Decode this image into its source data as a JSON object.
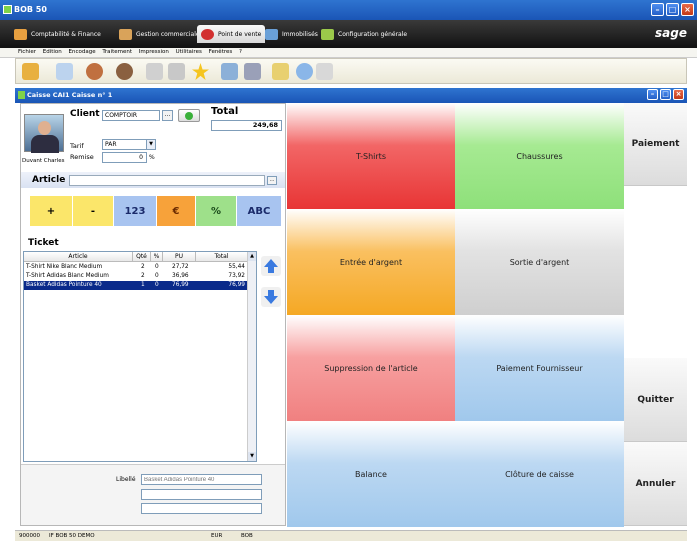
{
  "app": {
    "title": "BOB 50"
  },
  "modules": [
    {
      "label": "Comptabilité & Finance",
      "icon": "ledger-icon"
    },
    {
      "label": "Gestion commerciale",
      "icon": "commerce-icon"
    },
    {
      "label": "Point de vente",
      "icon": "pos-icon"
    },
    {
      "label": "Immobilisés",
      "icon": "assets-icon"
    },
    {
      "label": "Configuration générale",
      "icon": "config-icon"
    }
  ],
  "brand": "sage",
  "menu": [
    "Fichier",
    "Edition",
    "Encodage",
    "Traitement",
    "Impression",
    "Utilitaires",
    "Fenêtres",
    "?"
  ],
  "caisse_window": {
    "title": "Caisse   CAI1   Caisse n° 1"
  },
  "client": {
    "label": "Client",
    "value": "COMPTOIR",
    "name": "Duvant Charles",
    "tarif_label": "Tarif",
    "tarif_value": "PAR",
    "remise_label": "Remise",
    "remise_value": "0",
    "remise_unit": "%"
  },
  "total": {
    "label": "Total",
    "value": "249,68"
  },
  "article": {
    "label": "Article",
    "value": ""
  },
  "keypad": [
    "+",
    "-",
    "123",
    "€",
    "%",
    "ABC"
  ],
  "ticket": {
    "label": "Ticket",
    "columns": [
      "Article",
      "Qté",
      "%",
      "PU",
      "Total"
    ],
    "rows": [
      {
        "article": "T-Shirt Nike Blanc Medium",
        "qte": "2",
        "pct": "0",
        "pu": "27,72",
        "total": "55,44",
        "selected": false
      },
      {
        "article": "T-Shirt Adidas Blanc Medium",
        "qte": "2",
        "pct": "0",
        "pu": "36,96",
        "total": "73,92",
        "selected": false
      },
      {
        "article": "Basket Adidas Pointure 40",
        "qte": "1",
        "pct": "0",
        "pu": "76,99",
        "total": "76,99",
        "selected": true
      }
    ]
  },
  "libelle": {
    "label": "Libellé",
    "placeholder": "Basket Adidas Pointure 40"
  },
  "categories": [
    {
      "label": "T-Shirts",
      "color": "#f04646"
    },
    {
      "label": "Chaussures",
      "color": "#8ee07a"
    },
    {
      "label": "Entrée d'argent",
      "color": "#f7b030"
    },
    {
      "label": "Sortie d'argent",
      "color": "#d8d8d8"
    },
    {
      "label": "Suppression de l'article",
      "color": "#f58c8c"
    },
    {
      "label": "Paiement Fournisseur",
      "color": "#a9ceee"
    },
    {
      "label": "Balance",
      "color": "#a9ceee"
    },
    {
      "label": "Clôture de caisse",
      "color": "#a9ceee"
    }
  ],
  "actions": {
    "paiement": "Paiement",
    "quitter": "Quitter",
    "annuler": "Annuler"
  },
  "status": {
    "code": "900000",
    "info": "IF BOB 50 DEMO",
    "currency": "EUR",
    "app": "BOB"
  }
}
